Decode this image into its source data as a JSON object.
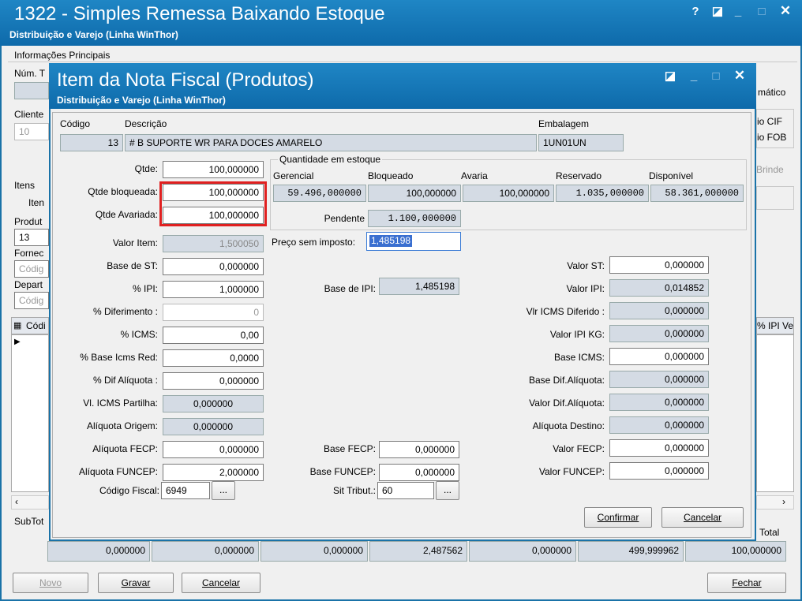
{
  "window": {
    "title": "1322 - Simples Remessa Baixando Estoque",
    "subtitle": "Distribuição e Varejo (Linha WinThor)",
    "controls": [
      "?",
      "◪",
      "_",
      "□",
      "✕"
    ]
  },
  "background": {
    "tab_label": "Informações Principais",
    "num_label": "Núm. T",
    "cliente_label": "Cliente",
    "cliente_value": "10",
    "itens_label": "Itens",
    "iten_tab": "Iten",
    "produto_label": "Produt",
    "produto_value": "13",
    "fornec_label": "Fornec",
    "fornec_placeholder": "Códig",
    "depart_label": "Depart",
    "depart_placeholder": "Códig",
    "grid_col": "Códi",
    "automatico": "mático",
    "cif": "io CIF",
    "fob": "io FOB",
    "brinde": "Brinde",
    "ipi_col": "% IPI Ve",
    "subtotal_label": "SubTot",
    "total_label": "Total",
    "totals": [
      "0,000000",
      "0,000000",
      "0,000000",
      "2,487562",
      "0,000000",
      "499,999962",
      "100,000000"
    ]
  },
  "dialog": {
    "title": "Item da Nota Fiscal (Produtos)",
    "subtitle": "Distribuição e Varejo (Linha WinThor)",
    "controls": [
      "◪",
      "_",
      "□",
      "✕"
    ],
    "codigo_label": "Código",
    "codigo_value": "13",
    "descricao_label": "Descrição",
    "descricao_value": "# B SUPORTE WR PARA DOCES AMARELO",
    "embalagem_label": "Embalagem",
    "embalagem_value": "1UN01UN",
    "left_fields": {
      "qtde": {
        "label": "Qtde:",
        "value": "100,000000"
      },
      "qtde_bloqueada": {
        "label": "Qtde bloqueada:",
        "value": "100,000000"
      },
      "qtde_avariada": {
        "label": "Qtde Avariada:",
        "value": "100,000000"
      },
      "valor_item": {
        "label": "Valor Item:",
        "value": "1,500050"
      },
      "base_st": {
        "label": "Base de ST:",
        "value": "0,000000"
      },
      "pct_ipi": {
        "label": "% IPI:",
        "value": "1,000000"
      },
      "pct_diferimento": {
        "label": "% Diferimento :",
        "value": "0"
      },
      "pct_icms": {
        "label": "% ICMS:",
        "value": "0,00"
      },
      "pct_base_icms_red": {
        "label": "% Base Icms Red:",
        "value": "0,0000"
      },
      "pct_dif_aliquota": {
        "label": "% Dif Alíquota :",
        "value": "0,000000"
      },
      "vl_icms_partilha": {
        "label": "Vl. ICMS Partilha:",
        "value": "0,000000"
      },
      "aliquota_origem": {
        "label": "Alíquota Origem:",
        "value": "0,000000"
      },
      "aliquota_fecp": {
        "label": "Alíquota FECP:",
        "value": "0,000000"
      },
      "aliquota_funcep": {
        "label": "Alíquota FUNCEP:",
        "value": "2,000000"
      },
      "codigo_fiscal": {
        "label": "Código Fiscal:",
        "value": "6949"
      }
    },
    "estoque": {
      "legend": "Quantidade em estoque",
      "headers": [
        "Gerencial",
        "Bloqueado",
        "Avaria",
        "Reservado",
        "Disponível"
      ],
      "values": [
        "59.496,000000",
        "100,000000",
        "100,000000",
        "1.035,000000",
        "58.361,000000"
      ],
      "pendente_label": "Pendente",
      "pendente_value": "1.100,000000"
    },
    "preco_sem_imposto": {
      "label": "Preço sem imposto:",
      "value": "1,485198"
    },
    "base_ipi": {
      "label": "Base de IPI:",
      "value": "1,485198"
    },
    "base_fecp": {
      "label": "Base FECP:",
      "value": "0,000000"
    },
    "base_funcep": {
      "label": "Base FUNCEP:",
      "value": "0,000000"
    },
    "sit_tribut": {
      "label": "Sit Tribut.:",
      "value": "60"
    },
    "right_fields": {
      "valor_st": {
        "label": "Valor ST:",
        "value": "0,000000"
      },
      "valor_ipi": {
        "label": "Valor IPI:",
        "value": "0,014852"
      },
      "vlr_icms_diferido": {
        "label": "Vlr ICMS Diferido :",
        "value": "0,000000"
      },
      "valor_ipi_kg": {
        "label": "Valor IPI KG:",
        "value": "0,000000"
      },
      "base_icms": {
        "label": "Base ICMS:",
        "value": "0,000000"
      },
      "base_dif_aliquota": {
        "label": "Base Dif.Alíquota:",
        "value": "0,000000"
      },
      "valor_dif_aliquota": {
        "label": "Valor Dif.Alíquota:",
        "value": "0,000000"
      },
      "aliquota_destino": {
        "label": "Alíquota Destino:",
        "value": "0,000000"
      },
      "valor_fecp": {
        "label": "Valor FECP:",
        "value": "0,000000"
      },
      "valor_funcep": {
        "label": "Valor FUNCEP:",
        "value": "0,000000"
      }
    },
    "ellipsis": "...",
    "confirmar_label": "Confirmar",
    "cancelar_label": "Cancelar"
  },
  "footer": {
    "novo": "Novo",
    "gravar": "Gravar",
    "cancelar": "Cancelar",
    "fechar": "Fechar"
  },
  "colors": {
    "titlebar": "#1a73a8",
    "highlight": "#e02020",
    "readonly_field": "#d4dbe4"
  }
}
